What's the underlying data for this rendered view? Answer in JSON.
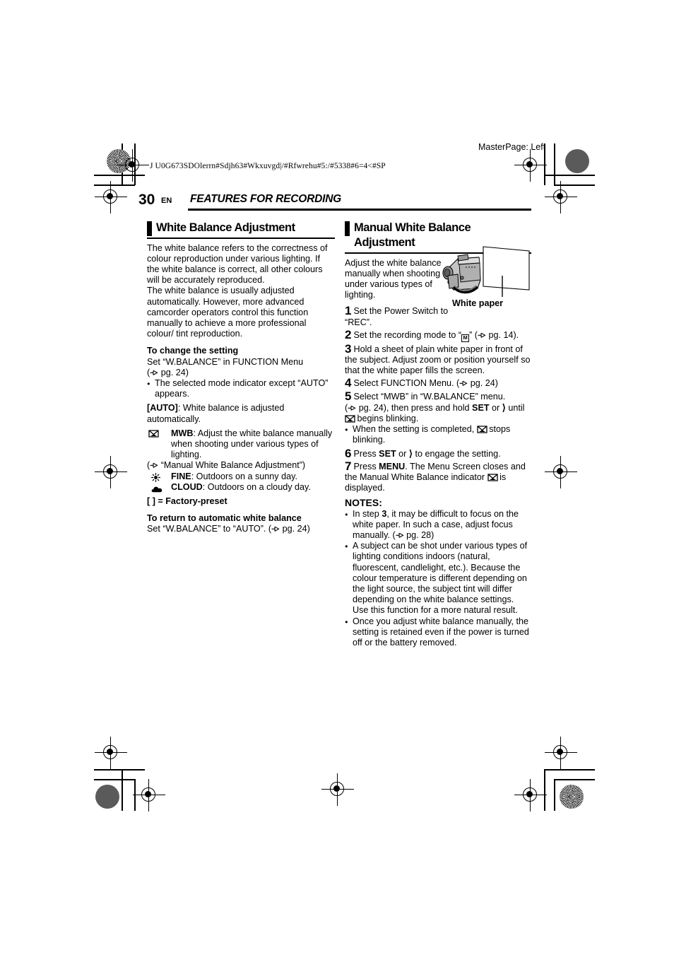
{
  "slug": {
    "code": "J U0G673SDOlerrn#Sdjh63#Wkxuvgd|/#Rfwrehu#5:/#5338#6=4<#SP",
    "masterpage": "MasterPage: Left"
  },
  "header": {
    "page_number": "30",
    "locale": "EN",
    "chapter_title": "FEATURES FOR RECORDING"
  },
  "left_column": {
    "section_title": "White Balance Adjustment",
    "intro_p1": "The white balance refers to the correctness of colour reproduction under various lighting. If the white balance is correct, all other colours will be accurately reproduced.",
    "intro_p2": "The white balance is usually adjusted automatically. However, more advanced camcorder operators control this function manually to achieve a more professional colour/ tint reproduction.",
    "change_heading": "To change the setting",
    "change_line1": "Set “W.BALANCE” in FUNCTION Menu",
    "change_line2_pg": "pg. 24)",
    "change_bullet": "The selected mode indicator except “AUTO” appears.",
    "auto_label": "[AUTO]",
    "auto_text": ": White balance is adjusted automatically.",
    "mwb_label": "MWB",
    "mwb_text": ": Adjust the white balance manually when shooting under various types of lighting.",
    "mwb_ref": "“Manual White Balance Adjustment”)",
    "fine_label": "FINE",
    "fine_text": ": Outdoors on a sunny day.",
    "cloud_label": "CLOUD",
    "cloud_text": ": Outdoors on a cloudy day.",
    "factory_preset": "[ ] = Factory-preset",
    "return_heading": "To return to automatic white balance",
    "return_text_a": "Set “W.BALANCE” to “AUTO”. (",
    "return_text_b": "pg. 24)"
  },
  "right_column": {
    "section_title": "Manual White Balance Adjustment",
    "intro": "Adjust the white balance manually when shooting under various types of lighting.",
    "illustration_caption": "White paper",
    "steps": [
      {
        "num": "1",
        "text": "Set the Power Switch to “REC”."
      },
      {
        "num": "2",
        "text": "Set the recording mode to “” ( pg. 14)."
      },
      {
        "num": "3",
        "text": "Hold a sheet of plain white paper in front of the subject. Adjust zoom or position yourself so that the white paper fills the screen."
      },
      {
        "num": "4",
        "text": "Select FUNCTION Menu. ( pg. 24)"
      },
      {
        "num": "5",
        "text": "Select “MWB” in “W.BALANCE” menu."
      },
      {
        "num": "6",
        "text": "Press  SET or  to engage the setting."
      },
      {
        "num": "7",
        "text": "Press MENU. The Menu Screen closes and the Manual White Balance indicator  is displayed."
      }
    ],
    "step2_pre": "Set the recording mode to “",
    "step2_post": "” (",
    "step2_pg": "pg. 14).",
    "step3_text": "Hold a sheet of plain white paper in front of the subject. Adjust zoom or position yourself so that the white paper fills the screen.",
    "step4_pre": "Select FUNCTION Menu. (",
    "step4_pg": "pg. 24)",
    "step5_line1": "Select “MWB” in “W.BALANCE” menu.",
    "step5_line2a": "pg. 24), then press and hold ",
    "step5_set": "SET",
    "step5_or": " or ",
    "step5_until": " until",
    "step5_line3": " begins blinking.",
    "step5_bullet_a": "When the setting is completed, ",
    "step5_bullet_b": " stops blinking.",
    "step6_pre": "Press ",
    "step6_set": "SET",
    "step6_or": " or ",
    "step6_post": " to engage the setting.",
    "step7_pre": "Press ",
    "step7_menu": "MENU",
    "step7_mid": ". The Menu Screen closes and the Manual White Balance indicator ",
    "step7_post": " is displayed.",
    "notes_title": "NOTES:",
    "note1_a": "In step ",
    "note1_b": "3",
    "note1_c": ", it may be difficult to focus on the white paper. In such a case, adjust focus manually.",
    "note1_pg": "pg. 28)",
    "note2": "A subject can be shot under various types of lighting conditions indoors (natural, fluorescent, candlelight, etc.). Because the colour temperature is different depending on the light source, the subject tint will differ depending on the white balance settings. Use this function for a more natural result.",
    "note3": "Once you adjust white balance manually, the setting is retained even if the power is turned off or the battery removed."
  },
  "icons": {
    "hand_pointer": "hand-pointer-icon",
    "mwb": "mwb-envelope-icon",
    "fine": "sun-icon",
    "cloud": "cloud-icon",
    "mode_m": "M",
    "arrow_right": "›"
  },
  "colors": {
    "ink": "#000000",
    "paper": "#ffffff",
    "camera_body": "#b9b9b9",
    "camera_dark": "#8a8a8a"
  }
}
